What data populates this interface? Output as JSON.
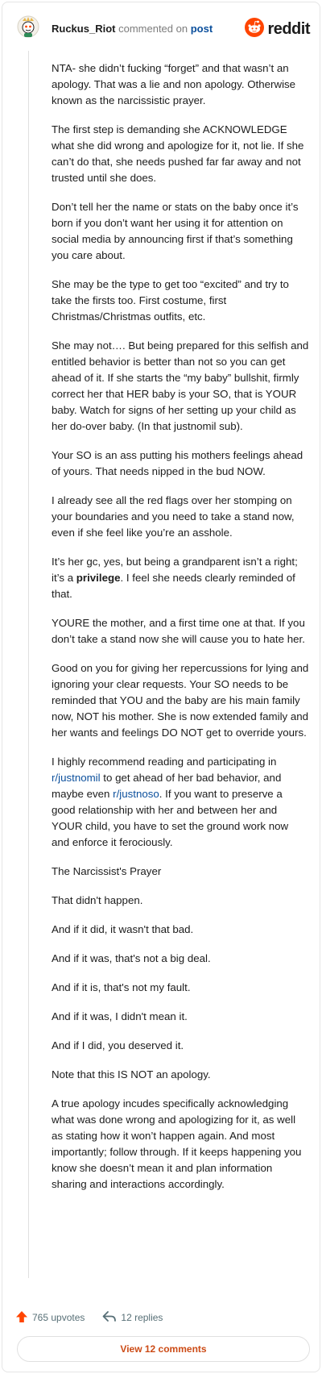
{
  "header": {
    "username": "Ruckus_Riot",
    "verb": "commented on",
    "link": "post",
    "brand": "reddit"
  },
  "comment": {
    "p1": "NTA- she didn’t fucking “forget” and that wasn’t an apology. That was a lie and non apology. Otherwise known as the narcissistic prayer.",
    "p2": "The first step is demanding she ACKNOWLEDGE what she did wrong and apologize for it, not lie. If she can’t do that, she needs pushed far far away and not trusted until she does.",
    "p3": "Don’t tell her the name or stats on the baby once it’s born if you don’t want her using it for attention on social media by announcing first if that’s something you care about.",
    "p4": "She may be the type to get too “excited” and try to take the firsts too. First costume, first Christmas/Christmas outfits, etc.",
    "p5": "She may not…. But being prepared for this selfish and entitled behavior is better than not so you can get ahead of it. If she starts the “my baby” bullshit, firmly correct her that HER baby is your SO, that is YOUR baby. Watch for signs of her setting up your child as her do-over baby. (In that justnomil sub).",
    "p6": "Your SO is an ass putting his mothers feelings ahead of yours. That needs nipped in the bud NOW.",
    "p7": "I already see all the red flags over her stomping on your boundaries and you need to take a stand now, even if she feel like you’re an asshole.",
    "p8_a": "It’s her gc, yes, but being a grandparent isn’t a right; it’s a ",
    "p8_bold": "privilege",
    "p8_b": ". I feel she needs clearly reminded of that.",
    "p9": "YOURE the mother, and a first time one at that. If you don’t take a stand now she will cause you to hate her.",
    "p10": "Good on you for giving her repercussions for lying and ignoring your clear requests. Your SO needs to be reminded that YOU and the baby are his main family now, NOT his mother. She is now extended family and her wants and feelings DO NOT get to override yours.",
    "p11_a": "I highly recommend reading and participating in ",
    "p11_link1": "r/justnomil",
    "p11_b": " to get ahead of her bad behavior, and maybe even ",
    "p11_link2": "r/justnoso",
    "p11_c": ". If you want to preserve a good relationship with her and between her and YOUR child, you have to set the ground work now and enforce it ferociously.",
    "p12": "The Narcissist's Prayer",
    "p13": "That didn't happen.",
    "p14": "And if it did, it wasn't that bad.",
    "p15": "And if it was, that's not a big deal.",
    "p16": "And if it is, that's not my fault.",
    "p17": "And if it was, I didn't mean it.",
    "p18": "And if I did, you deserved it.",
    "p19": "Note that this IS NOT an apology.",
    "p20": "A true apology incudes specifically acknowledging what was done wrong and apologizing for it, as well as stating how it won’t happen again. And most importantly; follow through. If it keeps happening you know she doesn’t mean it and plan information sharing and interactions accordingly."
  },
  "actions": {
    "upvotes": "765 upvotes",
    "replies": "12 replies",
    "view_comments": "View 12 comments"
  },
  "colors": {
    "upvote": "#ff4500",
    "link": "#0b4f9c",
    "view_button_text": "#cc4b16",
    "muted": "#576f76"
  },
  "icons": {
    "avatar": "snoo-avatar-icon",
    "brand": "reddit-logo-icon",
    "upvote": "upvote-arrow-icon",
    "reply": "reply-arrow-icon"
  }
}
